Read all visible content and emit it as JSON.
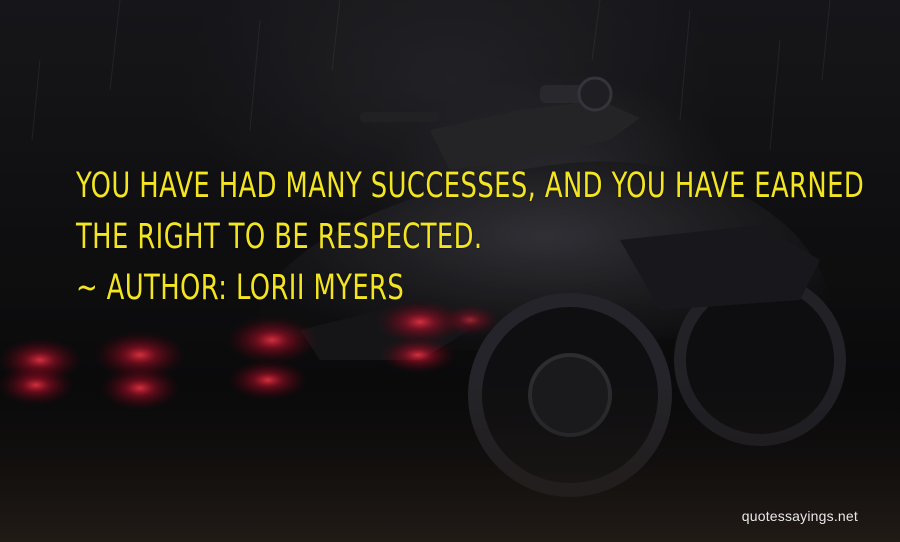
{
  "quote": {
    "line1": "YOU HAVE HAD MANY SUCCESSES, AND YOU HAVE EARNED",
    "line2": "THE RIGHT TO BE RESPECTED.",
    "author_line": "~ AUTHOR: LORII MYERS"
  },
  "watermark": "quotessayings.net",
  "colors": {
    "quote_text": "#f3e521",
    "watermark_text": "#e8e8e8",
    "tail_lights": "#c8102e"
  }
}
